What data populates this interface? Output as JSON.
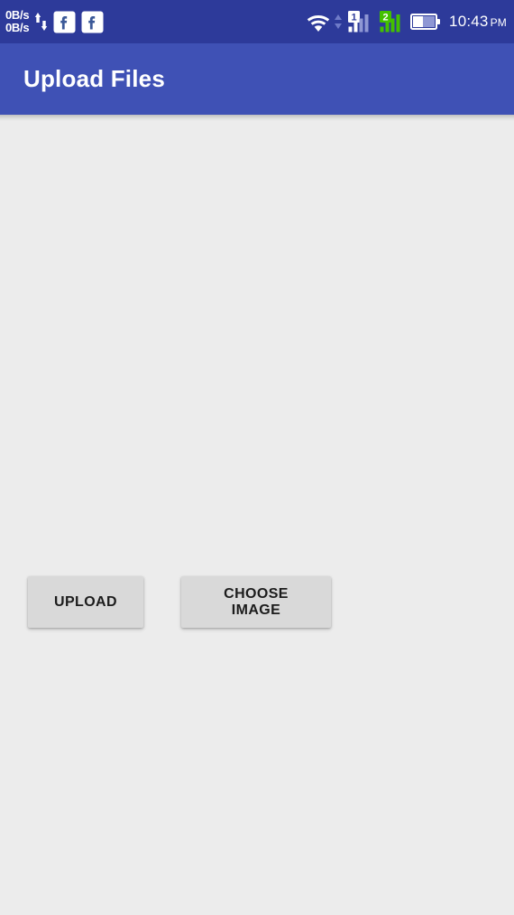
{
  "status_bar": {
    "network_speed_up": "0B/s",
    "network_speed_down": "0B/s",
    "transfer_arrows_icon": "up-down-arrows-icon",
    "notifications": [
      {
        "icon": "facebook-icon",
        "label": "Facebook"
      },
      {
        "icon": "facebook-icon",
        "label": "Facebook"
      }
    ],
    "wifi_icon": "wifi-icon",
    "wifi_data_arrows_icon": "data-transfer-arrows-icon",
    "sim1": {
      "badge": "1",
      "icon": "signal-bars-icon",
      "badge_color": "#ffffff",
      "badge_text_color": "#2d3a9a"
    },
    "sim2": {
      "badge": "2",
      "icon": "signal-bars-icon",
      "badge_color": "#43c000",
      "badge_text_color": "#ffffff"
    },
    "battery_icon": "battery-half-icon",
    "time": "10:43",
    "time_period": "PM",
    "background_color": "#2d3a9a"
  },
  "app_bar": {
    "title": "Upload Files",
    "background_color": "#3f51b5",
    "text_color": "#ffffff"
  },
  "content": {
    "background_color": "#ececec",
    "buttons": [
      {
        "label": "UPLOAD",
        "name": "upload-button"
      },
      {
        "label": "CHOOSE IMAGE",
        "name": "choose-image-button"
      }
    ],
    "button_color": "#d9d9d9",
    "button_text_color": "#1c1c1c"
  }
}
